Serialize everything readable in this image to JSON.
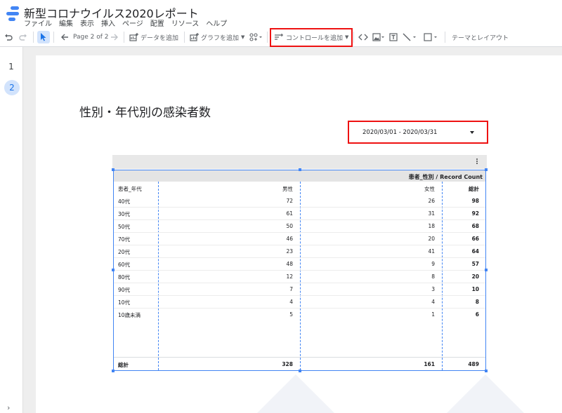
{
  "app": {
    "title": "新型コロナウイルス2020レポート",
    "menu": [
      "ファイル",
      "編集",
      "表示",
      "挿入",
      "ページ",
      "配置",
      "リソース",
      "ヘルプ"
    ],
    "brand_color": "#4285f4"
  },
  "toolbar": {
    "page_indicator": "Page 2 of 2",
    "add_data": "データを追加",
    "add_chart": "グラフを追加",
    "add_control": "コントロールを追加",
    "theme_layout": "テーマとレイアウト"
  },
  "pages": {
    "items": [
      "1",
      "2"
    ],
    "active_index": 1
  },
  "report": {
    "title": "性別・年代別の感染者数",
    "date_range": "2020/03/01 - 2020/03/31"
  },
  "table": {
    "pivot_header": "患者_性別 / Record Count",
    "columns": [
      "患者_年代",
      "男性",
      "女性",
      "総計"
    ],
    "rows": [
      {
        "age": "40代",
        "male": "72",
        "female": "26",
        "total": "98"
      },
      {
        "age": "30代",
        "male": "61",
        "female": "31",
        "total": "92"
      },
      {
        "age": "50代",
        "male": "50",
        "female": "18",
        "total": "68"
      },
      {
        "age": "70代",
        "male": "46",
        "female": "20",
        "total": "66"
      },
      {
        "age": "20代",
        "male": "23",
        "female": "41",
        "total": "64"
      },
      {
        "age": "60代",
        "male": "48",
        "female": "9",
        "total": "57"
      },
      {
        "age": "80代",
        "male": "12",
        "female": "8",
        "total": "20"
      },
      {
        "age": "90代",
        "male": "7",
        "female": "3",
        "total": "10"
      },
      {
        "age": "10代",
        "male": "4",
        "female": "4",
        "total": "8"
      },
      {
        "age": "10歳未満",
        "male": "5",
        "female": "1",
        "total": "6"
      }
    ],
    "totals": {
      "label": "総計",
      "male": "328",
      "female": "161",
      "total": "489"
    }
  },
  "highlight_color": "#ee1111"
}
